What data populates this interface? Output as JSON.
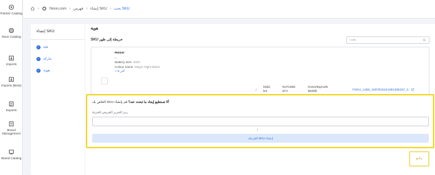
{
  "rail": {
    "items": [
      {
        "label": "Partner Catalog",
        "icon": "catalog-icon"
      },
      {
        "label": "Noon Catalog",
        "icon": "noon-catalog-icon"
      },
      {
        "label": "Imports",
        "icon": "import-icon"
      },
      {
        "label": "Imports (Beta)",
        "icon": "import-beta-icon"
      },
      {
        "label": "Exports",
        "icon": "export-icon"
      },
      {
        "label": "Brand Management",
        "icon": "brand-management-icon"
      },
      {
        "label": "Brand Catalog",
        "icon": "brand-catalog-icon"
      }
    ]
  },
  "breadcrumb": {
    "store": "Noon.com",
    "level1": "فهرس",
    "level2": "إنشاء SKU",
    "level3": "بحث SKU"
  },
  "steps": {
    "title": "إنشاء SKU",
    "items": [
      "فئة",
      "ماركة",
      "هوية"
    ]
  },
  "main": {
    "heading": "هوية",
    "subheading": "SKU خريطة إلى ظهر",
    "search_placeholder": "بحث"
  },
  "product": {
    "brand": "Honor",
    "dash": "--",
    "battery_label": "Battery size:",
    "battery_value": "4000",
    "colour_label": "Colour name:",
    "colour_value": "Magic Night Black",
    "more": "+ آخر 6",
    "category_line1": "Mobi",
    "category_line2": "les",
    "model_line1": "N471655",
    "model_line2": "87A",
    "partner_line1": "Honor9xpro25",
    "partner_line2": "6bsblk",
    "sku_link": "FSKU_1455_4287915241091285237_X"
  },
  "cant_find": {
    "prefix": "الخاص بك SKU",
    "bold": "ألا تستطيع إيجاد ما تبحث عنه؟",
    "suffix": "قم بإنشاء",
    "label": "رمز التحرير التعريفي للجزيئة",
    "input_value": "",
    "create_button": "اقترحك SKU إنشاء"
  },
  "next_button": "يتابع",
  "colors": {
    "accent": "#2d6fe0",
    "highlight": "#f2d72a"
  }
}
